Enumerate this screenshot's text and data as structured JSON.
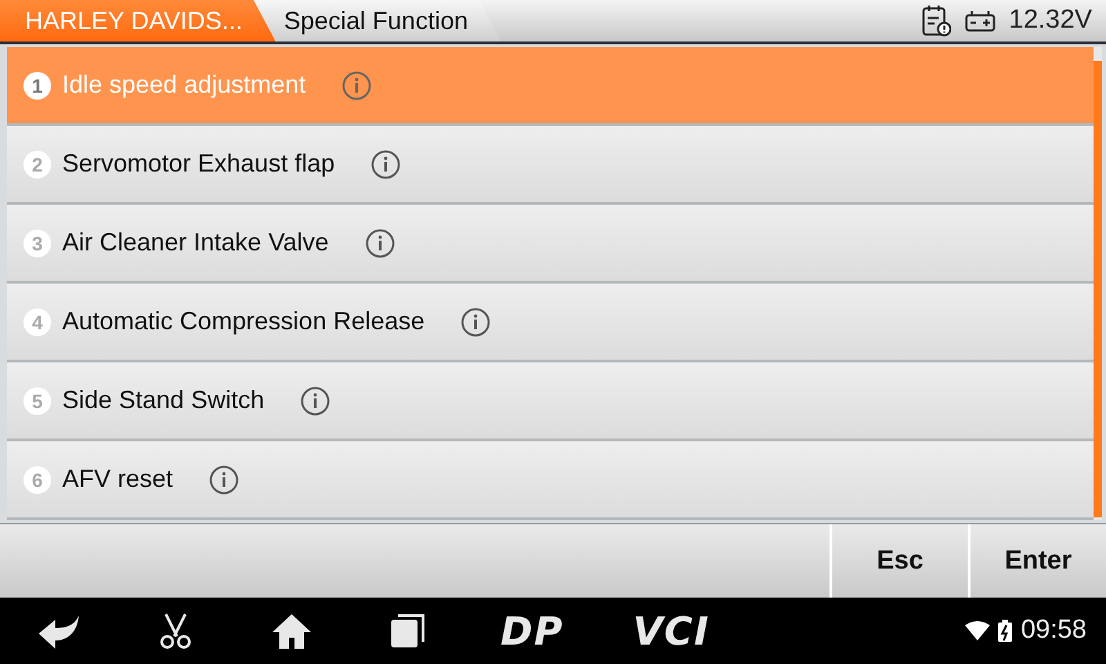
{
  "breadcrumbs": [
    {
      "label": "HARLEY DAVIDS...",
      "selected": true
    },
    {
      "label": "Special Function",
      "selected": false
    }
  ],
  "status": {
    "voltage": "12.32V"
  },
  "items": [
    {
      "number": "1",
      "label": "Idle speed adjustment",
      "selected": true
    },
    {
      "number": "2",
      "label": "Servomotor Exhaust flap",
      "selected": false
    },
    {
      "number": "3",
      "label": "Air Cleaner Intake Valve",
      "selected": false
    },
    {
      "number": "4",
      "label": "Automatic Compression Release",
      "selected": false
    },
    {
      "number": "5",
      "label": "Side Stand Switch",
      "selected": false
    },
    {
      "number": "6",
      "label": "AFV reset",
      "selected": false
    }
  ],
  "buttons": [
    "Esc",
    "Enter"
  ],
  "nav_bar": {
    "logos": [
      "DP",
      "VCI"
    ],
    "time": "09:58"
  }
}
